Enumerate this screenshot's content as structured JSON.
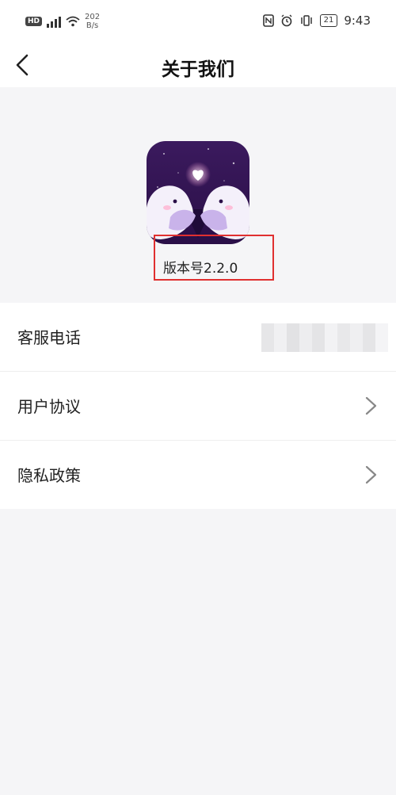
{
  "status_bar": {
    "network_badge": "HD",
    "network_speed_value": "202",
    "network_speed_unit": "B/s",
    "battery": "21",
    "time": "9:43",
    "icons": [
      "nfc-icon",
      "alarm-icon",
      "vibrate-icon",
      "battery-icon"
    ]
  },
  "header": {
    "title": "关于我们",
    "back_icon": "chevron-left-icon"
  },
  "app_info": {
    "icon": "app-logo-icon",
    "version_label": "版本号2.2.0",
    "highlight_color": "#e03030"
  },
  "list": {
    "items": [
      {
        "label": "客服电话",
        "value": "",
        "value_obscured": true
      },
      {
        "label": "用户协议",
        "chevron": "chevron-right-icon"
      },
      {
        "label": "隐私政策",
        "chevron": "chevron-right-icon"
      }
    ]
  },
  "colors": {
    "background": "#f5f5f7",
    "surface": "#ffffff",
    "accent_purple": "#3b1a5e",
    "highlight_red": "#e03030"
  }
}
